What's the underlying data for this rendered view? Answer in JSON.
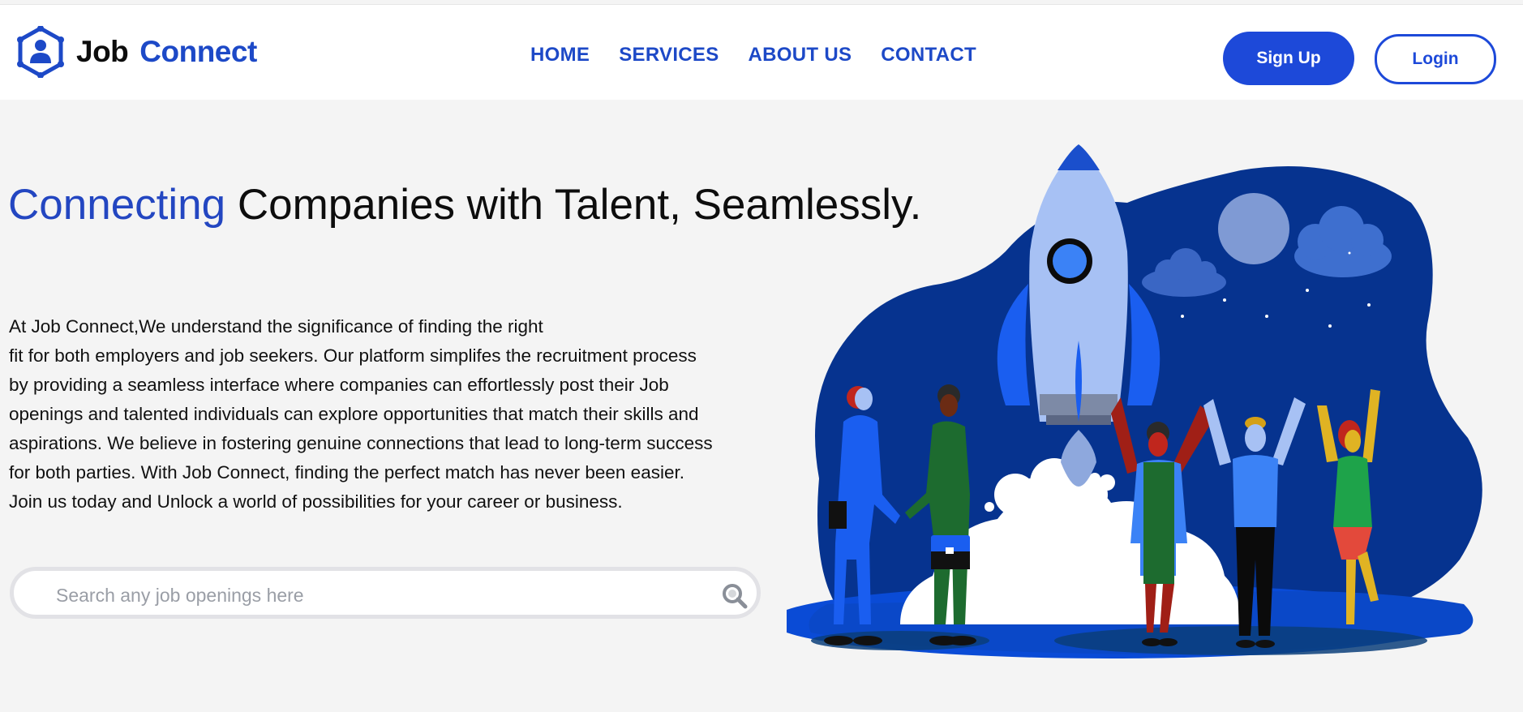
{
  "brand": {
    "name_part1": "Job",
    "name_part2": "Connect",
    "accent_color": "#1d49c7"
  },
  "nav": {
    "items": [
      {
        "label": "HOME"
      },
      {
        "label": "SERVICES"
      },
      {
        "label": "ABOUT US"
      },
      {
        "label": "CONTACT"
      }
    ]
  },
  "auth": {
    "signup_label": "Sign Up",
    "login_label": "Login"
  },
  "hero": {
    "title_accent": "Connecting",
    "title_rest": " Companies with Talent, Seamlessly.",
    "description_lines": [
      "At Job Connect,We understand the significance of finding the right",
      "fit for both employers and job seekers. Our platform simplifes the recruitment process",
      "by providing a seamless interface where companies can effortlessly post their Job",
      "openings and talented individuals can explore opportunities that match their skills and",
      "aspirations. We believe in fostering genuine connections that lead to long-term success",
      "for both parties. With Job Connect, finding the perfect match has never been easier.",
      "Join us today and Unlock a world of possibilities for your career or business."
    ]
  },
  "search": {
    "placeholder": "Search any job openings here",
    "value": "",
    "icon": "search-icon"
  },
  "illustration": {
    "name": "rocket-launch-team-illustration",
    "bg_color": "#06338f",
    "accent_color": "#3b82f6"
  }
}
